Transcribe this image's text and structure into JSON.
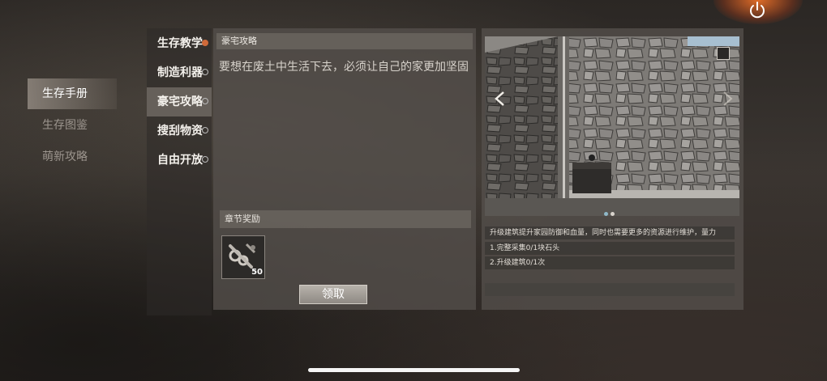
{
  "categories": [
    "生存手册",
    "生存图鉴",
    "萌新攻略"
  ],
  "sub_menu": [
    "生存教学",
    "制造利器",
    "豪宅攻略",
    "搜刮物资",
    "自由开放"
  ],
  "panel": {
    "title": "豪宅攻略",
    "description": "要想在废土中生活下去，必须让自己的家更加坚固",
    "reward_label": "章节奖励",
    "reward_count": "50",
    "claim_label": "领取"
  },
  "tasks": {
    "summary": "升级建筑提升家园防御和血量，同时也需要更多的资源进行维护，量力",
    "task_1": "1.完整采集0/1块石头",
    "task_2": "2.升级建筑0/1次"
  },
  "colors": {
    "accent_dot": "#cf6a3a",
    "power_glow": "#ff7828"
  },
  "icons": [
    "power-icon",
    "arrow-left-icon",
    "arrow-right-icon",
    "fullscreen-icon",
    "wrench-kit-icon"
  ]
}
